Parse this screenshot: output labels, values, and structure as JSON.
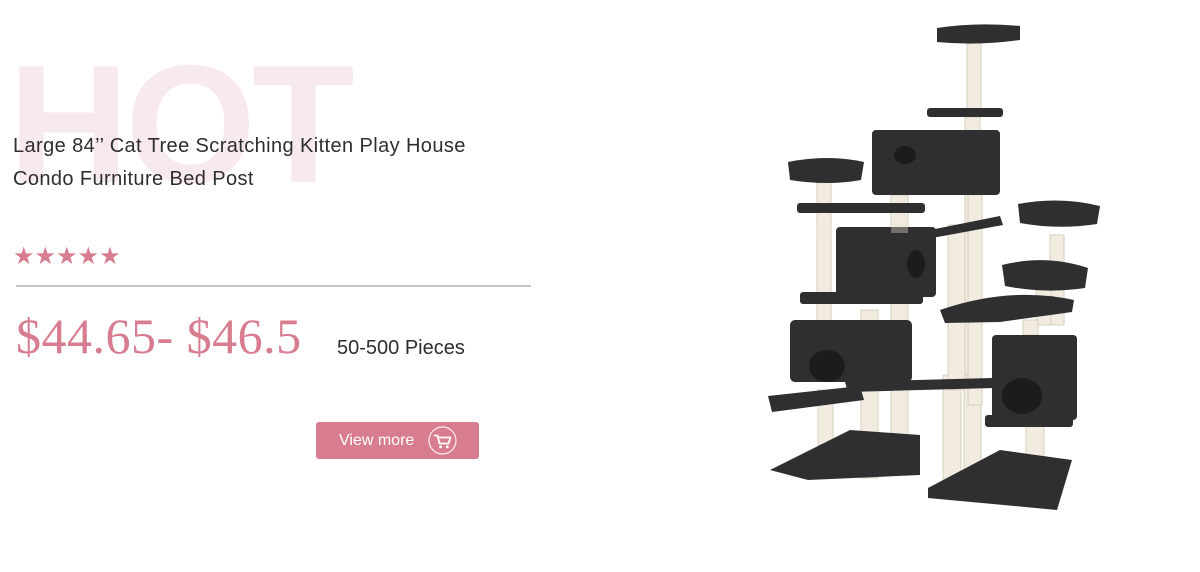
{
  "watermark": "HOT",
  "product": {
    "title_line1": "Large 84’’ Cat Tree Scratching Kitten Play House",
    "title_line2": "Condo Furniture Bed Post",
    "rating_stars": "★★★★★",
    "rating": 5,
    "price": "$44.65- $46.5",
    "quantity": "50-500 Pieces"
  },
  "actions": {
    "view_more_label": "View more",
    "view_more_icon": "shopping-cart-icon"
  },
  "colors": {
    "accent": "#d87d8f",
    "watermark": "#f8e9ec",
    "text": "#2e2e2e",
    "divider": "#c7c7c7",
    "product_dark": "#2f2f31",
    "product_sisal": "#f1ecdf"
  }
}
